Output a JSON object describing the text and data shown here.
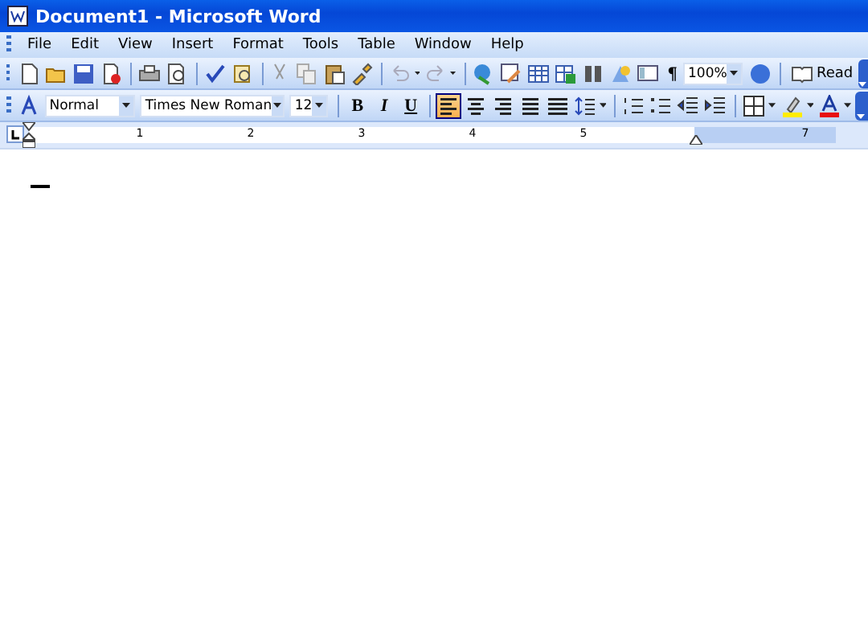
{
  "window": {
    "title": "Document1 - Microsoft Word"
  },
  "menu": [
    "File",
    "Edit",
    "View",
    "Insert",
    "Format",
    "Tools",
    "Table",
    "Window",
    "Help"
  ],
  "standard_toolbar": {
    "show_formatting": "¶",
    "zoom": "100%",
    "read": "Read"
  },
  "formatting_toolbar": {
    "style": "Normal",
    "font": "Times New Roman",
    "size": "12",
    "bold": "B",
    "italic": "I",
    "underline": "U",
    "alignment": [
      {
        "selected": true
      },
      {
        "selected": false
      },
      {
        "selected": false
      },
      {
        "selected": false
      },
      {
        "selected": false
      }
    ]
  },
  "ruler": [
    "1",
    "2",
    "3",
    "4",
    "5",
    "7"
  ]
}
